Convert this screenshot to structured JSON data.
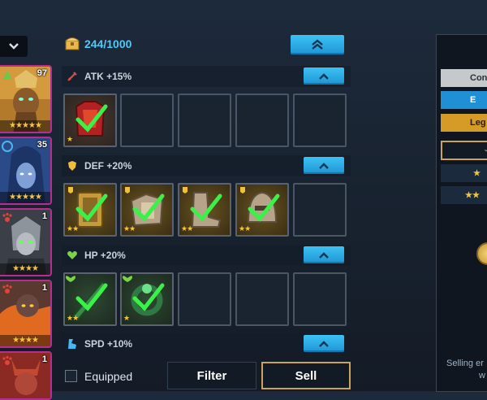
{
  "inventory": {
    "count": "244/1000"
  },
  "sections": [
    {
      "id": "atk",
      "label": "ATK +15%",
      "color": "#e24b4b"
    },
    {
      "id": "def",
      "label": "DEF +20%",
      "color": "#f0c03a"
    },
    {
      "id": "hp",
      "label": "HP +20%",
      "color": "#7bd34a"
    },
    {
      "id": "spd",
      "label": "SPD +10%",
      "color": "#4ab8f0"
    }
  ],
  "heroes": [
    {
      "level": "97",
      "stars": "★★★★★",
      "faction": "forest"
    },
    {
      "level": "35",
      "stars": "★★★★★",
      "faction": "water"
    },
    {
      "level": "1",
      "stars": "★★★★",
      "faction": "beast"
    },
    {
      "level": "1",
      "stars": "★★★★",
      "faction": "beast"
    },
    {
      "level": "1",
      "stars": "",
      "faction": "beast"
    }
  ],
  "item_stars": {
    "atk_1": "★",
    "def_1": "★★",
    "def_2": "★★",
    "def_3": "★★",
    "def_4": "★★",
    "hp_1": "★★",
    "hp_2": "★"
  },
  "bottom": {
    "equipped_label": "Equipped",
    "filter_label": "Filter",
    "sell_label": "Sell"
  },
  "right_panel": {
    "common": "Con",
    "epic": "E",
    "legend": "Leg",
    "dropdown": "",
    "star1": "★",
    "star2": "★★",
    "note_line1": "Selling er",
    "note_line2": "w"
  },
  "colors": {
    "accent_blue": "#2aaee8",
    "gold": "#c9a55c",
    "hero_border": "#b72e8e",
    "check_green": "#3cf04a"
  }
}
